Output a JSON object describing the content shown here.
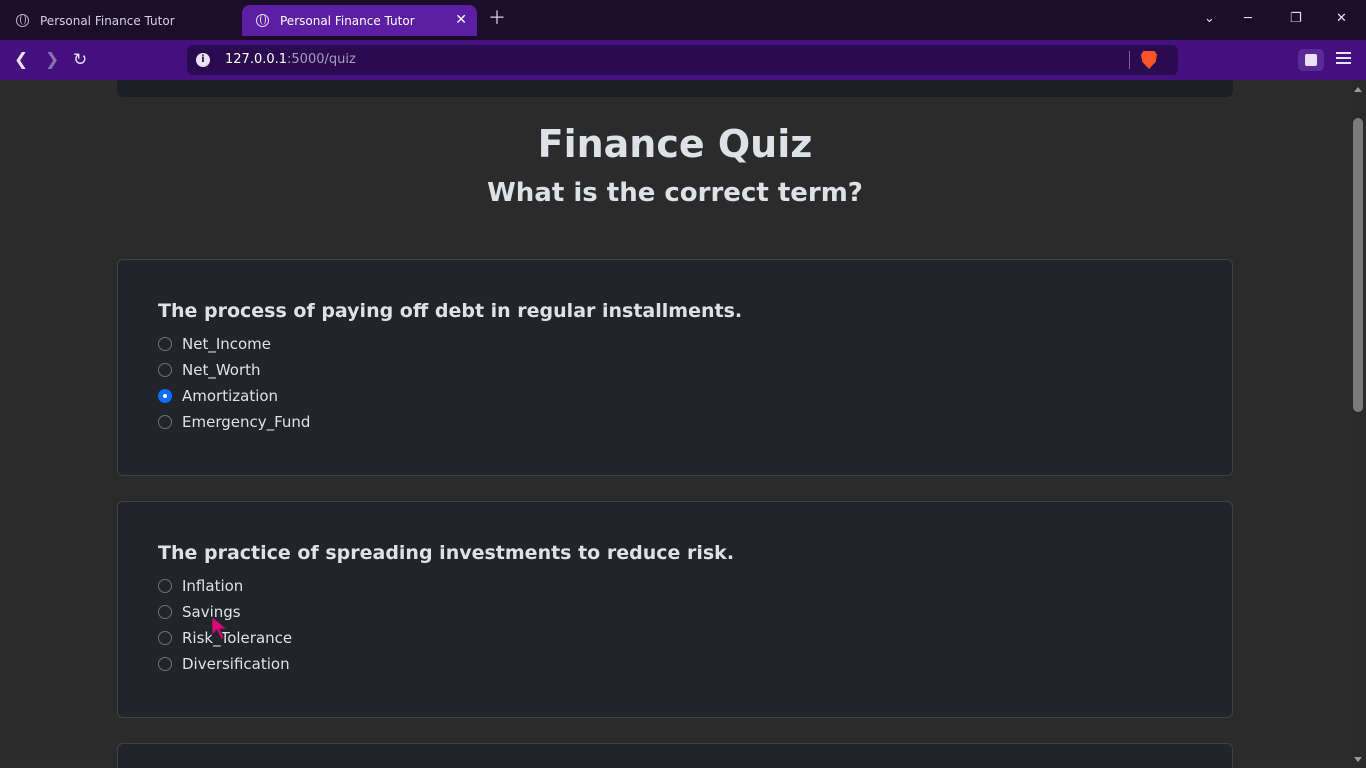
{
  "browser": {
    "tabs": [
      {
        "title": "Personal Finance Tutor",
        "active": false
      },
      {
        "title": "Personal Finance Tutor",
        "active": true
      }
    ],
    "url_host": "127.0.0.1",
    "url_path": ":5000/quiz",
    "info_icon": "i"
  },
  "page": {
    "title": "Finance Quiz",
    "subtitle": "What is the correct term?",
    "questions": [
      {
        "text": "The process of paying off debt in regular installments.",
        "options": [
          "Net_Income",
          "Net_Worth",
          "Amortization",
          "Emergency_Fund"
        ],
        "selected": "Amortization"
      },
      {
        "text": "The practice of spreading investments to reduce risk.",
        "options": [
          "Inflation",
          "Savings",
          "Risk_Tolerance",
          "Diversification"
        ],
        "selected": null
      }
    ]
  },
  "colors": {
    "tab_active": "#5c1fa3",
    "toolbar": "#440f7e",
    "radio_checked": "#0d6efd",
    "cursor": "#e6007e"
  }
}
